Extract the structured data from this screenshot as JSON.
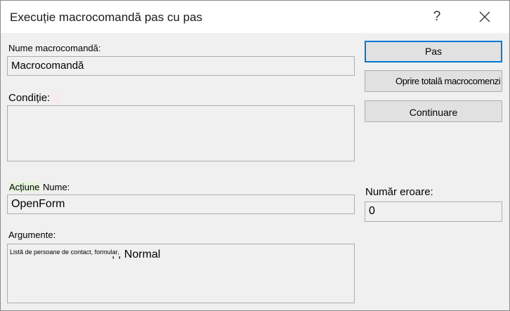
{
  "dialog": {
    "title": "Execuție macrocomandă pas cu pas",
    "help_label": "?"
  },
  "fields": {
    "macro_name_label": "Nume macrocomandă:",
    "macro_name_value": "Macrocomandă",
    "condition_label": "Condiție:",
    "action_label_prefix": "Acțiune",
    "action_label_suffix": "Nume:",
    "action_name_value": "OpenForm",
    "arguments_label": "Argumente:",
    "arguments_small": "Listă de persoane de contact, formular,",
    "arguments_large": ", , Normal",
    "error_number_label": "Număr eroare:",
    "error_number_value": "0"
  },
  "buttons": {
    "step_label": "Pas",
    "stop_all_label": "Oprire totală macrocomenzi",
    "continue_label": "Continuare"
  },
  "colors": {
    "accent": "#0078d7",
    "background": "#f0f0f0"
  }
}
